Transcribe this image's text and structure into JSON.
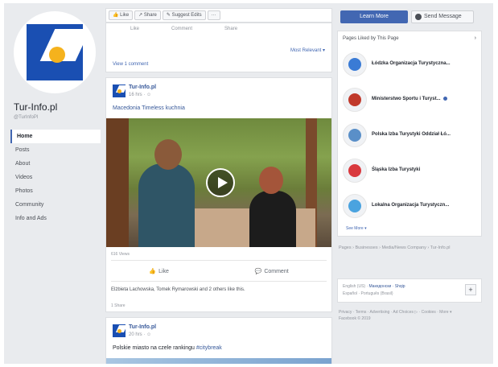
{
  "page": {
    "name": "Tur-Info.pl",
    "handle": "@TurInfoPl"
  },
  "nav": {
    "items": [
      "Home",
      "Posts",
      "About",
      "Videos",
      "Photos",
      "Community",
      "Info and Ads"
    ],
    "active": "Home"
  },
  "action_bar": {
    "like_label": "Like",
    "share_label": "Share",
    "suggest_label": "Suggest Edits",
    "more_label": "···"
  },
  "previous_post": {
    "reactions": [
      "Like",
      "Comment",
      "Share"
    ],
    "most_relevant": "Most Relevant ▾",
    "view_comment": "View 1 comment"
  },
  "post1": {
    "author": "Tur-Info.pl",
    "meta": "16 hrs · ☺",
    "text": "Macedonia Timeless kuchnia",
    "text_suffix": "",
    "views": "616 Views",
    "like_label": "Like",
    "comment_label": "Comment",
    "likes_line": "Elżbieta Lachowska, Tomek Rymarowski and 2 others like this.",
    "share_line": "1 Share"
  },
  "post2": {
    "author": "Tur-Info.pl",
    "meta": "20 hrs · ☺",
    "text": "Polskie miasto na czele rankingu",
    "tag": "#citybreak"
  },
  "right": {
    "learn_more": "Learn More",
    "send_message": "Send Message",
    "liked_title": "Pages Liked by This Page",
    "liked_pages": [
      {
        "name": "Łódzka Organizacja Turystyczna...",
        "color": "#3a7bd5",
        "verified": false
      },
      {
        "name": "Ministerstwo Sportu i Turyst...",
        "color": "#c0392b",
        "verified": true
      },
      {
        "name": "Polska Izba Turystyki Oddział Łó...",
        "color": "#5a8fc8",
        "verified": false
      },
      {
        "name": "Śląska Izba Turystyki",
        "color": "#d9393e",
        "verified": false
      },
      {
        "name": "Lokalna Organizacja Turystyczn...",
        "color": "#4aa3df",
        "verified": false
      }
    ],
    "see_more": "See More ▾",
    "breadcrumb": "Pages › Businesses › Media/News Company › Tur-Info.pl",
    "lang_line1_pre": "English (US) · ",
    "lang_line1_links": "Mакедонски · Shqip",
    "lang_line2": "Español · Português (Brasil)",
    "plus": "+",
    "footer_line1": "Privacy · Terms · Advertising · Ad Choices ▷ · Cookies · More ▾",
    "footer_line2": "Facebook © 2019"
  }
}
